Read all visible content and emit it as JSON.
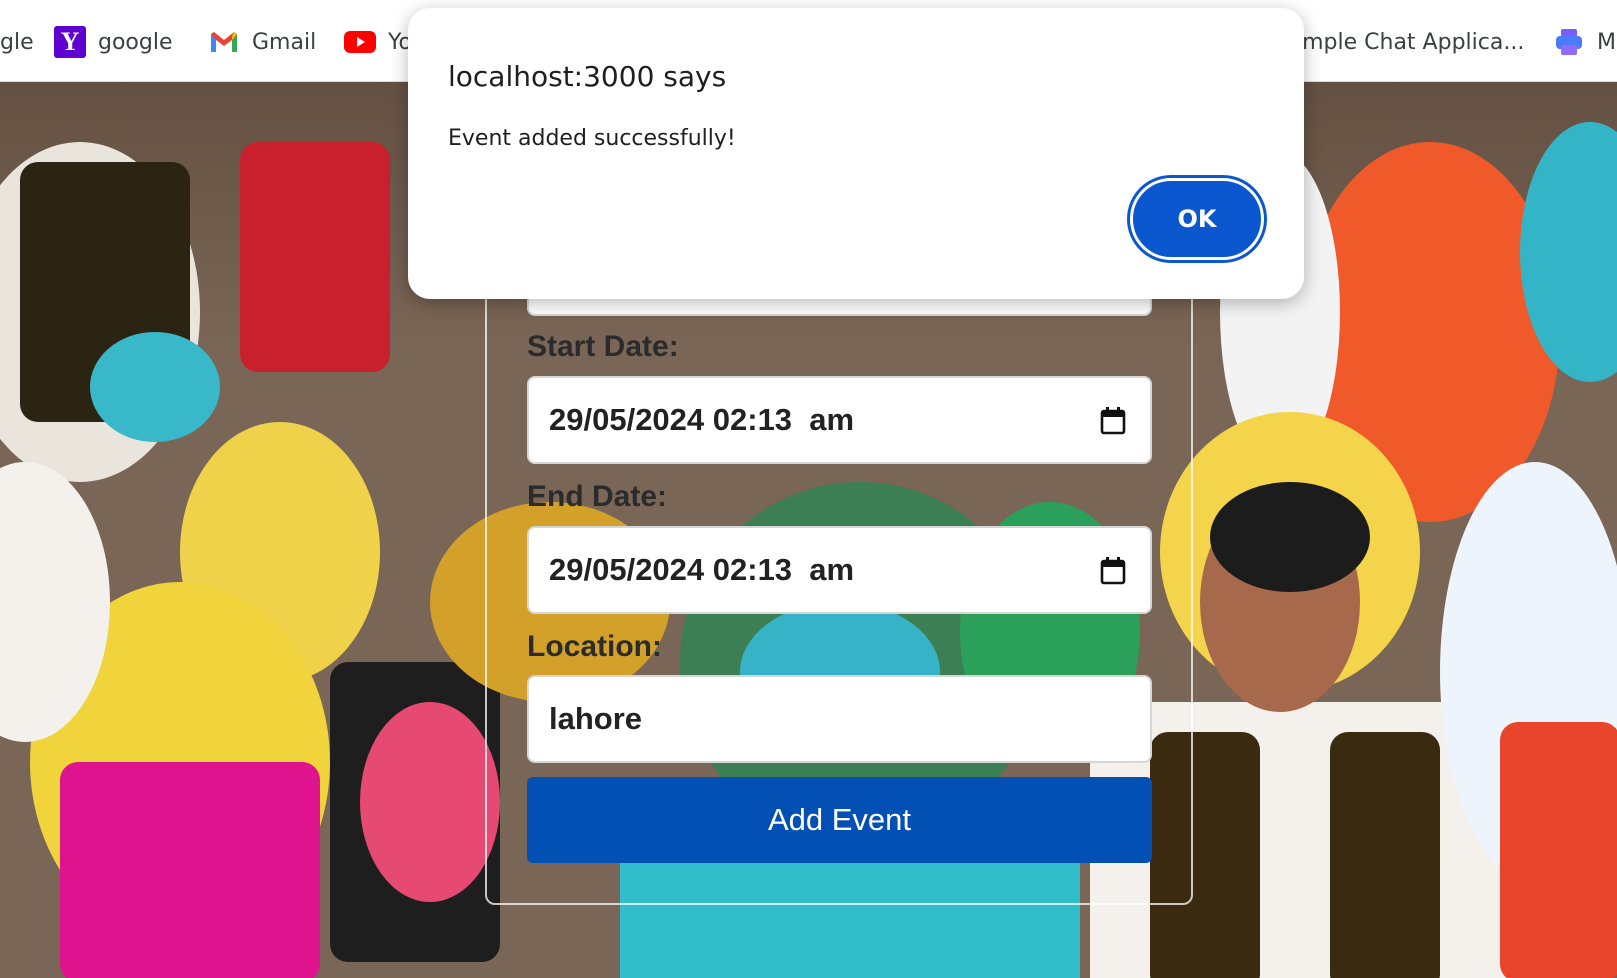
{
  "bookmarks": [
    {
      "label": "gle",
      "icon": "google-icon"
    },
    {
      "label": "google",
      "icon": "yahoo-icon"
    },
    {
      "label": "Gmail",
      "icon": "gmail-icon"
    },
    {
      "label": "Yo",
      "icon": "youtube-icon"
    },
    {
      "label": "imple Chat Applica...",
      "icon": ""
    },
    {
      "label": "M",
      "icon": "printer-icon"
    }
  ],
  "dialog": {
    "title": "localhost:3000 says",
    "message": "Event added successfully!",
    "ok_label": "OK"
  },
  "form": {
    "start_label": "Start Date:",
    "start_value": "29/05/2024 02:13  am",
    "end_label": "End Date:",
    "end_value": "29/05/2024 02:13  am",
    "location_label": "Location:",
    "location_value": "lahore",
    "submit_label": "Add Event"
  },
  "colors": {
    "primary_button": "#0350b4",
    "dialog_ok": "#0b57d0"
  }
}
